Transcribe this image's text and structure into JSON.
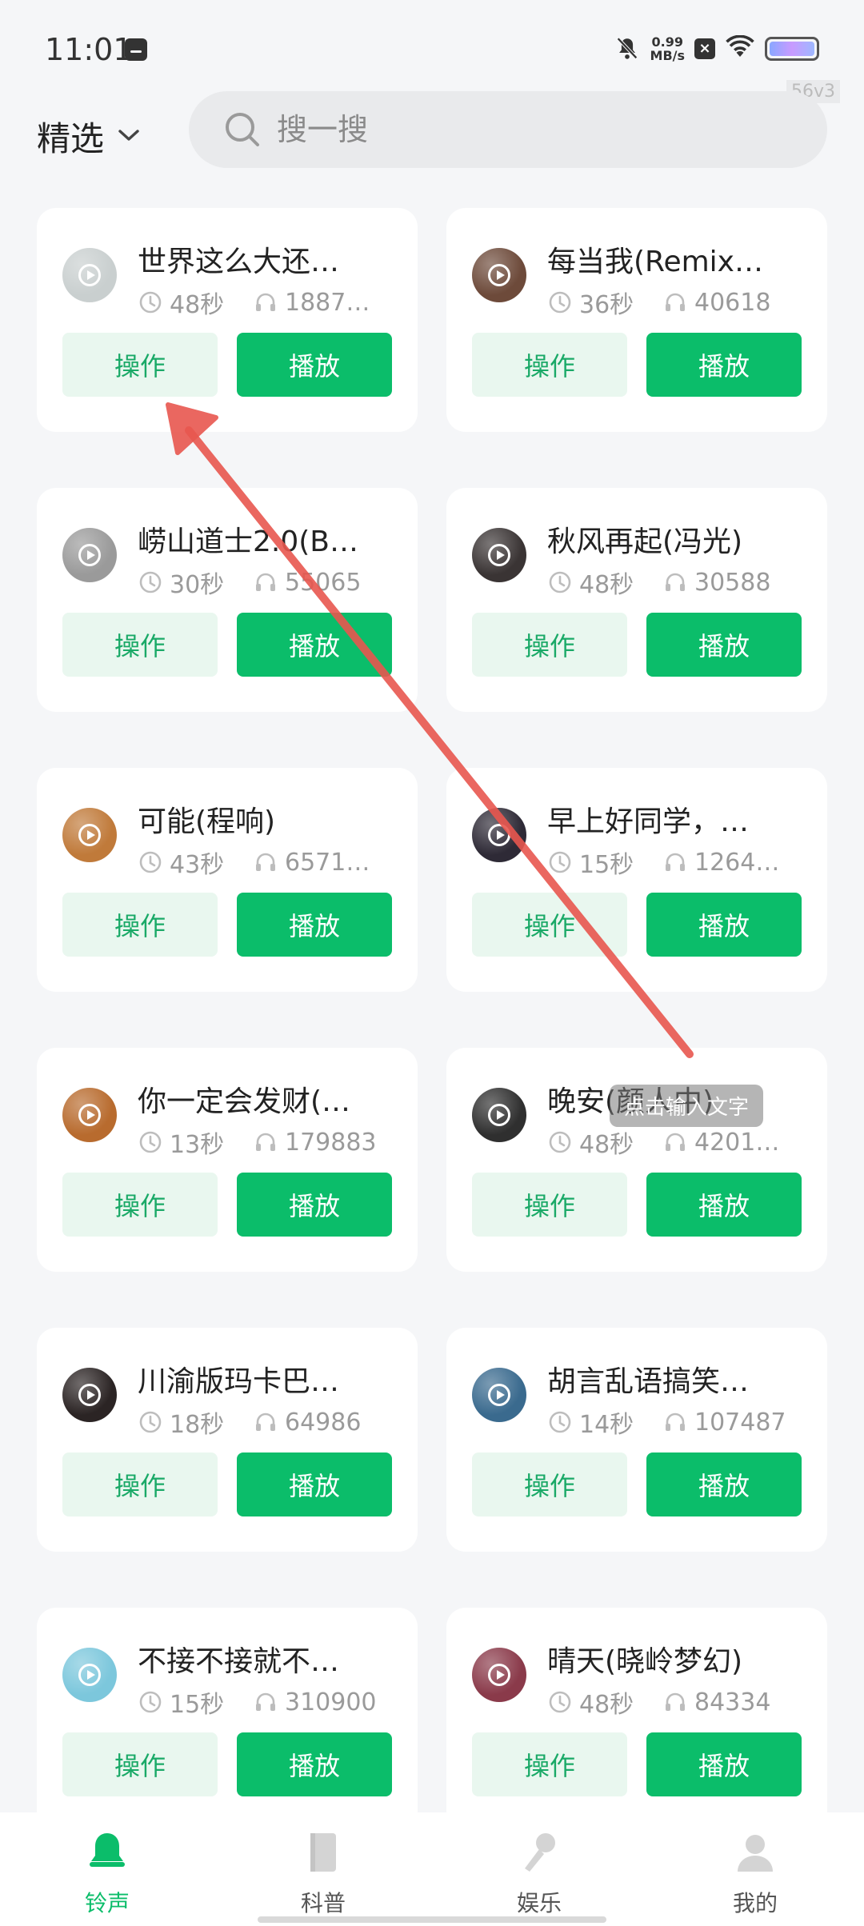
{
  "status_bar": {
    "time": "11:01",
    "net_speed_value": "0.99",
    "net_speed_unit": "MB/s",
    "build_tag": "56v3"
  },
  "header": {
    "filter_label": "精选",
    "search_placeholder": "搜一搜"
  },
  "buttons": {
    "operate": "操作",
    "play": "播放"
  },
  "cards": [
    {
      "title": "世界这么大还…",
      "duration": "48秒",
      "plays": "1887…",
      "avatar_color": "#c9cfcf"
    },
    {
      "title": "每当我(Remix…",
      "duration": "36秒",
      "plays": "40618",
      "avatar_color": "#6d4a3a"
    },
    {
      "title": "崂山道士2.0(B…",
      "duration": "30秒",
      "plays": "55065",
      "avatar_color": "#9a9a9a"
    },
    {
      "title": "秋风再起(冯光)",
      "duration": "48秒",
      "plays": "30588",
      "avatar_color": "#3a3434"
    },
    {
      "title": "可能(程响)",
      "duration": "43秒",
      "plays": "6571…",
      "avatar_color": "#c07a3a"
    },
    {
      "title": "早上好同学，…",
      "duration": "15秒",
      "plays": "1264…",
      "avatar_color": "#2e2a36"
    },
    {
      "title": "你一定会发财(…",
      "duration": "13秒",
      "plays": "179883",
      "avatar_color": "#b86b2e"
    },
    {
      "title": "晚安(颜人中)",
      "duration": "48秒",
      "plays": "4201…",
      "avatar_color": "#2f2f2f"
    },
    {
      "title": "川渝版玛卡巴…",
      "duration": "18秒",
      "plays": "64986",
      "avatar_color": "#2b2424"
    },
    {
      "title": "胡言乱语搞笑…",
      "duration": "14秒",
      "plays": "107487",
      "avatar_color": "#3a6a8e"
    },
    {
      "title": "不接不接就不…",
      "duration": "15秒",
      "plays": "310900",
      "avatar_color": "#7cc7dc"
    },
    {
      "title": "晴天(晓岭梦幻)",
      "duration": "48秒",
      "plays": "84334",
      "avatar_color": "#8a3a4a"
    }
  ],
  "overlay": {
    "hint": "点击输入文字",
    "arrow_color": "#e8574f"
  },
  "bottom_nav": {
    "items": [
      {
        "label": "铃声",
        "icon": "bell-icon",
        "active": true
      },
      {
        "label": "科普",
        "icon": "book-icon",
        "active": false
      },
      {
        "label": "娱乐",
        "icon": "microphone-icon",
        "active": false
      },
      {
        "label": "我的",
        "icon": "user-icon",
        "active": false
      }
    ]
  },
  "colors": {
    "accent": "#0bbd6a",
    "accent_light": "#e9f7ef",
    "background": "#f5f6f8"
  }
}
